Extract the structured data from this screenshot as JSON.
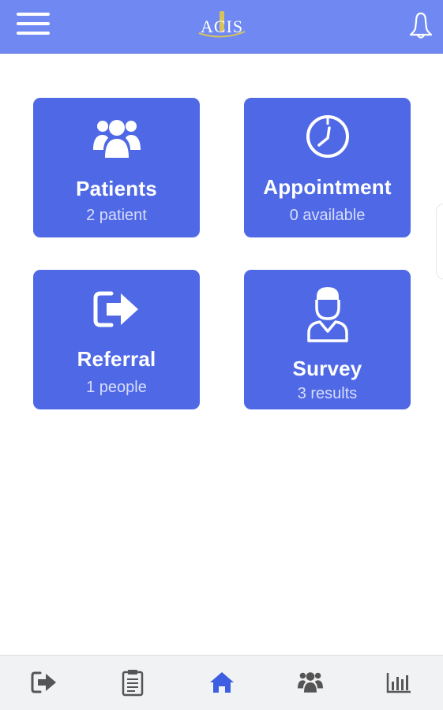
{
  "header": {
    "logo_text": "ACIS",
    "menu_icon": "menu-icon",
    "bell_icon": "bell-icon"
  },
  "colors": {
    "header_bg": "#7089f2",
    "card_bg": "#4f69e6",
    "nav_active": "#3b5fe0",
    "nav_inactive": "#555555"
  },
  "cards": [
    {
      "icon": "patients-group-icon",
      "title": "Patients",
      "subtitle": "2 patient"
    },
    {
      "icon": "clock-icon",
      "title": "Appointment",
      "subtitle": "0 available"
    },
    {
      "icon": "referral-exit-icon",
      "title": "Referral",
      "subtitle": "1 people"
    },
    {
      "icon": "doctor-icon",
      "title": "Survey",
      "subtitle": "3 results"
    }
  ],
  "bottom_nav": [
    {
      "icon": "logout-icon",
      "active": false
    },
    {
      "icon": "clipboard-icon",
      "active": false
    },
    {
      "icon": "home-icon",
      "active": true
    },
    {
      "icon": "group-icon",
      "active": false
    },
    {
      "icon": "bar-chart-icon",
      "active": false
    }
  ]
}
